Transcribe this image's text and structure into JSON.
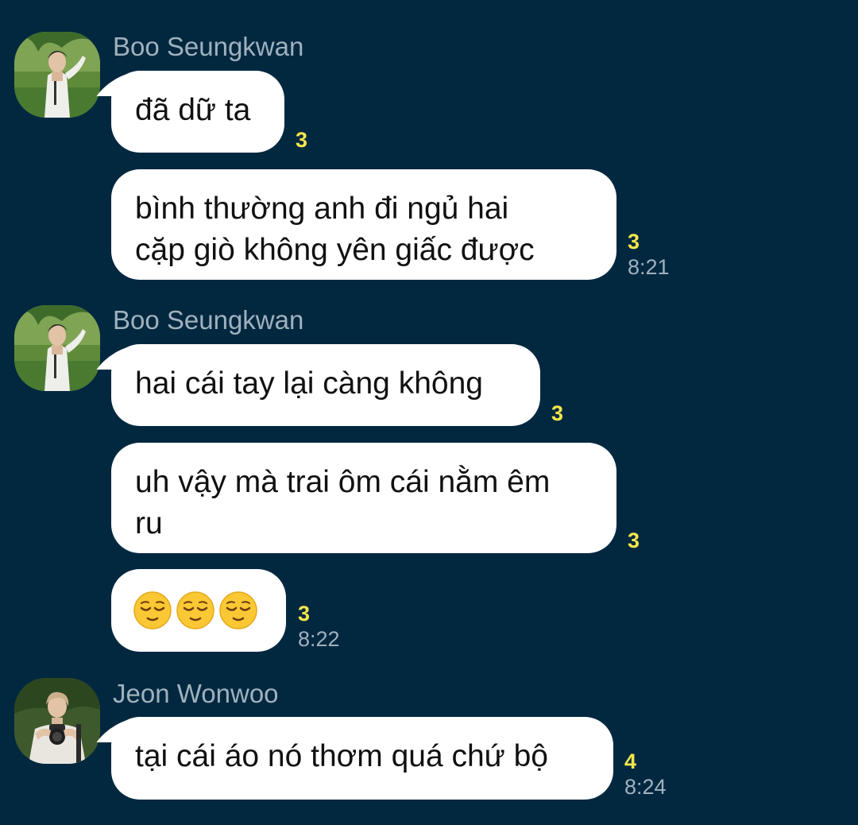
{
  "colors": {
    "background": "#022840",
    "bubble": "#ffffff",
    "unread": "#f5e64a",
    "meta": "#9fb1bd"
  },
  "groups": [
    {
      "sender": "Boo Seungkwan",
      "avatar_icon": "profile-photo-boo-seungkwan",
      "messages": [
        {
          "text": "đã dữ ta",
          "unread": "3",
          "time": ""
        },
        {
          "text": "bình thường anh đi ngủ hai\ncặp giò không yên giấc được",
          "unread": "3",
          "time": "8:21"
        }
      ]
    },
    {
      "sender": "Boo Seungkwan",
      "avatar_icon": "profile-photo-boo-seungkwan",
      "messages": [
        {
          "text": "hai cái tay lại càng không",
          "unread": "3",
          "time": ""
        },
        {
          "text": "uh vậy mà trai ôm cái nằm êm\nru",
          "unread": "3",
          "time": ""
        },
        {
          "emoji": [
            "relieved-face-icon",
            "relieved-face-icon",
            "relieved-face-icon"
          ],
          "unread": "3",
          "time": "8:22"
        }
      ]
    },
    {
      "sender": "Jeon Wonwoo",
      "avatar_icon": "profile-photo-jeon-wonwoo",
      "messages": [
        {
          "text": "tại cái áo nó thơm quá chứ bộ",
          "unread": "4",
          "time": "8:24"
        }
      ]
    }
  ]
}
